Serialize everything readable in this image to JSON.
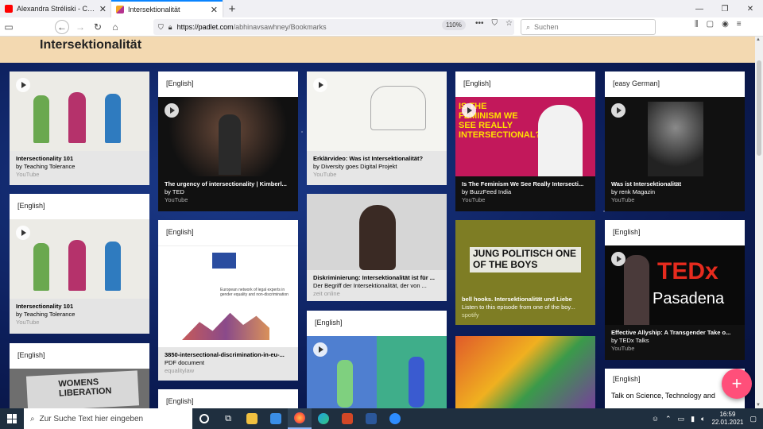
{
  "browser": {
    "tabs": [
      {
        "label": "Alexandra Stréliski - Changing",
        "active": false,
        "favicon_color": "#ff0000"
      },
      {
        "label": "Intersektionalität",
        "active": true,
        "favicon_color": "#b5328f"
      }
    ],
    "new_tab": "+",
    "url_domain": "https://padlet.com",
    "url_path": "/abhinavsawhney/Bookmarks",
    "zoom": "110%",
    "search_placeholder": "Suchen"
  },
  "padlet": {
    "title": "Intersektionalität",
    "add_button": "+",
    "cards": [
      {
        "id": "c1",
        "label": "",
        "title": "Intersectionality 101",
        "by": "by Teaching Tolerance",
        "source": "YouTube",
        "video": true
      },
      {
        "id": "c2",
        "label": "[English]",
        "title": "Intersectionality 101",
        "by": "by Teaching Tolerance",
        "source": "YouTube",
        "video": true
      },
      {
        "id": "c3",
        "label": "[English]",
        "title": "",
        "by": "",
        "source": "",
        "video": false,
        "sign_text": "WOMENS LIBERATION"
      },
      {
        "id": "c4",
        "label": "[English]",
        "title": "The urgency of intersectionality | Kimberl...",
        "by": "by TED",
        "source": "YouTube",
        "video": true
      },
      {
        "id": "c5",
        "label": "[English]",
        "title": "3850-intersectional-discrimination-in-eu-...",
        "by": "PDF document",
        "source": "equalitylaw",
        "video": false,
        "doc_text": "European network of legal experts in gender equality and non-discrimination"
      },
      {
        "id": "c6",
        "label": "[English]",
        "title": "",
        "by": "",
        "source": "",
        "video": false
      },
      {
        "id": "c7",
        "label": "",
        "title": "Erklärvideo: Was ist Intersektionalität?",
        "by": "by Diversity goes Digital Projekt",
        "source": "YouTube",
        "video": true
      },
      {
        "id": "c8",
        "label": "",
        "title": "Diskriminierung: Intersektionalität ist für ...",
        "by": "Der Begriff der Intersektionalität, der von ...",
        "source": "zeit online",
        "video": false
      },
      {
        "id": "c9",
        "label": "[English]",
        "title": "",
        "by": "",
        "source": "",
        "video": true
      },
      {
        "id": "c10",
        "label": "[English]",
        "title": "Is The Feminism We See Really Intersecti...",
        "by": "by BuzzFeed India",
        "source": "YouTube",
        "video": true,
        "thumb_text": "IS THE FEMINISM WE SEE REALLY INTERSECTIONAL?"
      },
      {
        "id": "c11",
        "label": "",
        "title": "bell hooks. Intersektionalität und Liebe",
        "by": "Listen to this episode from one of the boy...",
        "source": "spotify",
        "video": false,
        "thumb_text": "JUNG POLITISCH ONE OF THE BOYS"
      },
      {
        "id": "c12",
        "label": "",
        "title": "",
        "by": "",
        "source": "",
        "video": false
      },
      {
        "id": "c13",
        "label": "[easy German]",
        "title": "Was ist Intersektionalität",
        "by": "by renk Magazin",
        "source": "YouTube",
        "video": true
      },
      {
        "id": "c14",
        "label": "[English]",
        "title": "Effective Allyship: A Transgender Take o...",
        "by": "by TEDx Talks",
        "source": "YouTube",
        "video": true,
        "thumb_text_1": "TEDx",
        "thumb_text_2": "Pasadena"
      },
      {
        "id": "c15",
        "label": "[English]",
        "title": "Talk on Science, Technology and",
        "by": "",
        "source": "",
        "video": false
      }
    ]
  },
  "taskbar": {
    "search_placeholder": "Zur Suche Text hier eingeben",
    "time": "16:59",
    "date": "22.01.2021"
  }
}
